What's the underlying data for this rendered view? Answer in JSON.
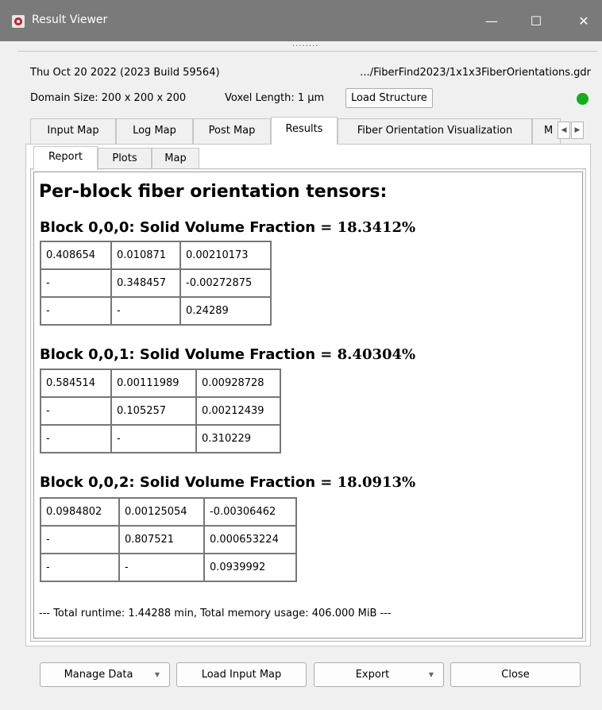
{
  "window": {
    "title": "Result Viewer",
    "minimize": "—",
    "maximize": "☐",
    "close": "✕",
    "grip": "........"
  },
  "info": {
    "date": "Thu Oct 20 2022 (2023 Build 59564)",
    "path": ".../FiberFind2023/1x1x3FiberOrientations.gdr",
    "domain_size": "Domain Size: 200 x 200 x 200",
    "voxel_length": "Voxel Length: 1 µm",
    "load_structure": "Load Structure",
    "status_color": "#10b01a"
  },
  "tabs": [
    {
      "label": "Input Map"
    },
    {
      "label": "Log Map"
    },
    {
      "label": "Post Map"
    },
    {
      "label": "Results"
    },
    {
      "label": "Fiber Orientation Visualization"
    },
    {
      "label": "M"
    }
  ],
  "active_tab": "Results",
  "subtabs": [
    {
      "label": "Report"
    },
    {
      "label": "Plots"
    },
    {
      "label": "Map"
    }
  ],
  "active_subtab": "Report",
  "report": {
    "heading": "Per-block fiber orientation tensors:",
    "blocks": [
      {
        "title": "Block 0,0,0: Solid Volume Fraction ",
        "eq": "= 18.3412%",
        "rows": [
          [
            "0.408654",
            "0.010871",
            "0.00210173"
          ],
          [
            "-",
            "0.348457",
            "-0.00272875"
          ],
          [
            "-",
            "-",
            "0.24289"
          ]
        ]
      },
      {
        "title": "Block 0,0,1: Solid Volume Fraction ",
        "eq": "= 8.40304%",
        "rows": [
          [
            "0.584514",
            "0.00111989",
            "0.00928728"
          ],
          [
            "-",
            "0.105257",
            "0.00212439"
          ],
          [
            "-",
            "-",
            "0.310229"
          ]
        ]
      },
      {
        "title": "Block 0,0,2: Solid Volume Fraction ",
        "eq": "= 18.0913%",
        "rows": [
          [
            "0.0984802",
            "0.00125054",
            "-0.00306462"
          ],
          [
            "-",
            "0.807521",
            "0.000653224"
          ],
          [
            "-",
            "-",
            "0.0939992"
          ]
        ]
      }
    ],
    "runtime": "--- Total runtime: 1.44288 min, Total memory usage: 406.000 MiB ---"
  },
  "buttons": {
    "manage_data": "Manage Data",
    "load_input_map": "Load Input Map",
    "export": "Export",
    "close": "Close"
  }
}
